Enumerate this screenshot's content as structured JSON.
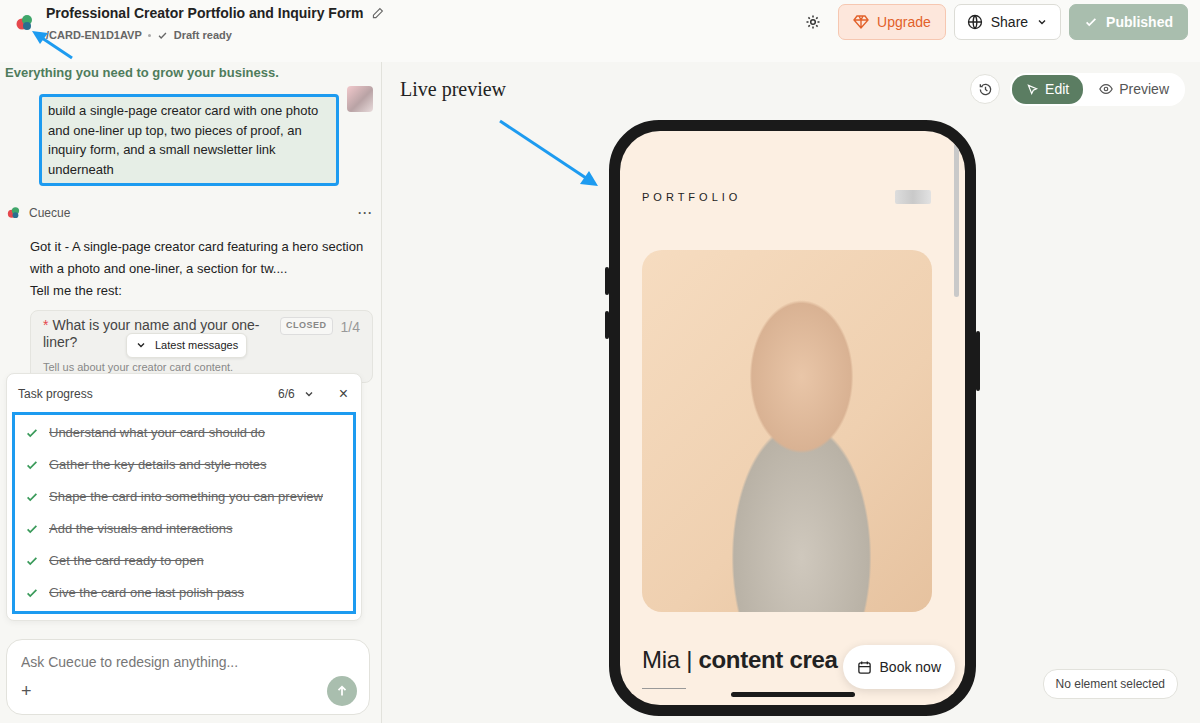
{
  "app": {
    "title": "Professional Creator Portfolio and Inquiry Form",
    "slug": "/CARD-EN1D1AVP",
    "status": "Draft ready"
  },
  "actions": {
    "upgrade": "Upgrade",
    "share": "Share",
    "published": "Published"
  },
  "chat": {
    "tagline": "Everything you need to grow your business.",
    "user_message": "build a single-page creator card with one photo and one-liner up top, two pieces of proof, an inquiry form, and a small newsletter link underneath",
    "assistant": {
      "name": "Cuecue",
      "menu": "···",
      "lines": [
        "Got it - A single-page creator card featuring a hero section with a photo and one-liner, a section for tw....",
        "Tell me the rest:"
      ]
    },
    "question": {
      "required": "*",
      "text": "What is your name and your one-liner?",
      "hint": "Tell us about your creator card content.",
      "status": "CLOSED",
      "step": "1/4"
    },
    "latest_button": "Latest messages"
  },
  "task_progress": {
    "title": "Task progress",
    "count": "6/6",
    "expanded": true,
    "close": "×",
    "items": [
      {
        "label": "Understand what your card should do",
        "done": true
      },
      {
        "label": "Gather the key details and style notes",
        "done": true
      },
      {
        "label": "Shape the card into something you can preview",
        "done": true
      },
      {
        "label": "Add the visuals and interactions",
        "done": true
      },
      {
        "label": "Get the card ready to open",
        "done": true
      },
      {
        "label": "Give the card one last polish pass",
        "done": true
      }
    ]
  },
  "composer": {
    "placeholder": "Ask Cuecue to redesign anything...",
    "add": "+"
  },
  "preview": {
    "title": "Live preview",
    "modes": [
      {
        "label": "Edit",
        "selected": true
      },
      {
        "label": "Preview",
        "selected": false
      }
    ],
    "card": {
      "eyebrow": "PORTFOLIO",
      "name": "Mia |",
      "role": "content crea",
      "book": "Book now"
    },
    "selection_status": "No element selected"
  }
}
